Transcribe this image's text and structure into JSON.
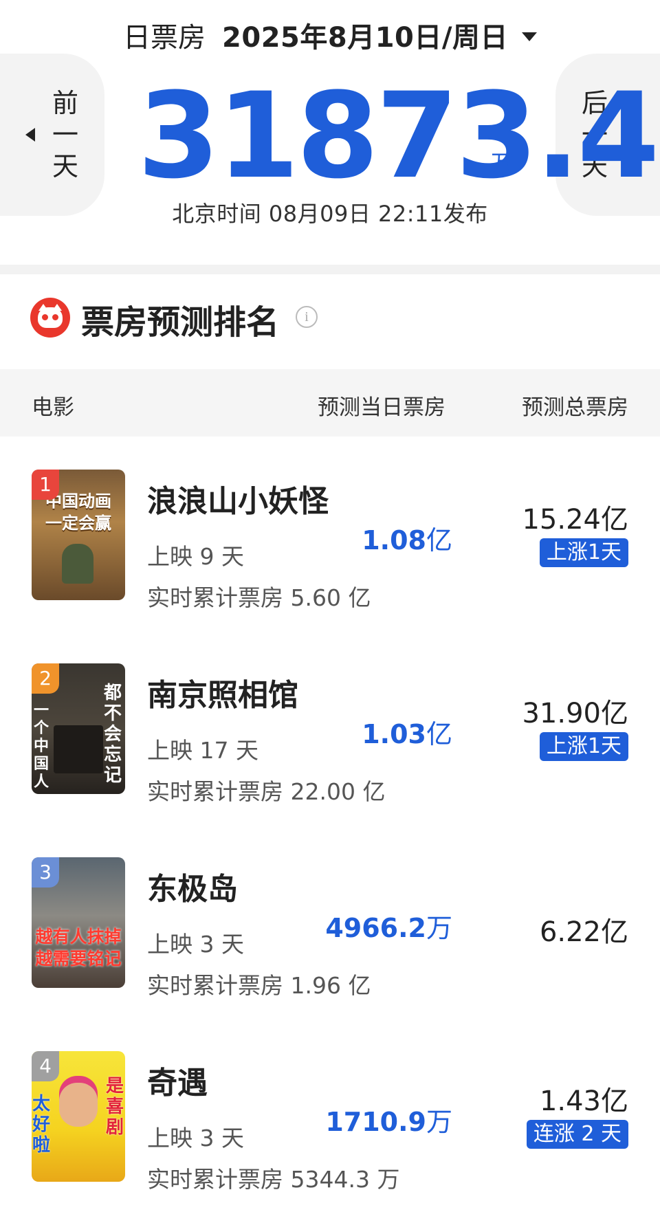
{
  "header": {
    "label": "日票房",
    "date": "2025年8月10日/周日",
    "prev": "前一天",
    "next": "后一天",
    "total": "31873.4",
    "unit": "万",
    "publish": "北京时间  08月09日  22:11发布"
  },
  "section": {
    "title": "票房预测排名",
    "info": "i"
  },
  "table": {
    "col_movie": "电影",
    "col_day": "预测当日票房",
    "col_total": "预测总票房"
  },
  "movies": [
    {
      "rank": "1",
      "title": "浪浪山小妖怪",
      "days": "上映 9 天",
      "cumulative": "实时累计票房 5.60 亿",
      "pred_day": "1.08",
      "pred_day_unit": "亿",
      "pred_total": "15.24亿",
      "badge": "上涨1天",
      "poster_text": "中国动画 一定会赢",
      "rank_color": "#e8453c"
    },
    {
      "rank": "2",
      "title": "南京照相馆",
      "days": "上映 17 天",
      "cumulative": "实时累计票房 22.00 亿",
      "pred_day": "1.03",
      "pred_day_unit": "亿",
      "pred_total": "31.90亿",
      "badge": "上涨1天",
      "poster_text": "都不会忘记",
      "rank_color": "#f0932b"
    },
    {
      "rank": "3",
      "title": "东极岛",
      "days": "上映 3 天",
      "cumulative": "实时累计票房 1.96 亿",
      "pred_day": "4966.2",
      "pred_day_unit": "万",
      "pred_total": "6.22亿",
      "badge": "",
      "poster_text": "越有人抹掉 越需要铭记",
      "rank_color": "#6b8fd6"
    },
    {
      "rank": "4",
      "title": "奇遇",
      "days": "上映 3 天",
      "cumulative": "实时累计票房 5344.3 万",
      "pred_day": "1710.9",
      "pred_day_unit": "万",
      "pred_total": "1.43亿",
      "badge": "连涨 2 天",
      "poster_text": "太好啦 是喜剧",
      "rank_color": "#a0a0a0"
    }
  ]
}
